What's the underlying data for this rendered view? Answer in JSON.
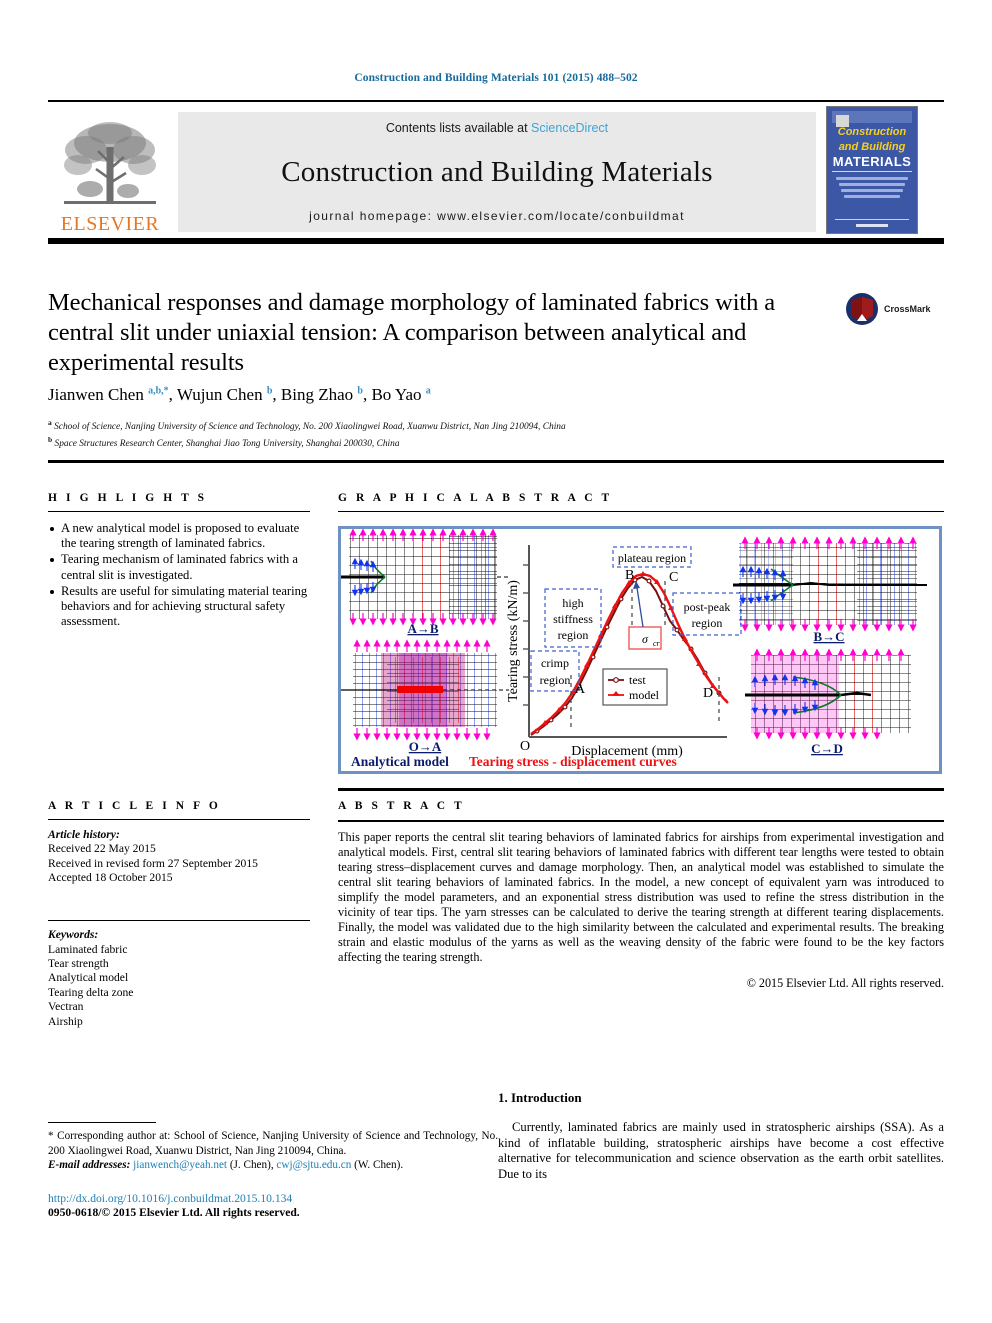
{
  "running_head": "Construction and Building Materials 101 (2015) 488–502",
  "masthead": {
    "contents_prefix": "Contents lists available at ",
    "sciencedirect": "ScienceDirect",
    "journal_name": "Construction and Building Materials",
    "homepage": "journal homepage: www.elsevier.com/locate/conbuildmat",
    "publisher_logo_text": "ELSEVIER",
    "cover": {
      "line1": "Construction",
      "line2": "and Building",
      "line3": "MATERIALS"
    }
  },
  "article": {
    "title": "Mechanical responses and damage morphology of laminated fabrics with a central slit under uniaxial tension: A comparison between analytical and experimental results",
    "crossmark_label": "CrossMark",
    "authors_html": "Jianwen Chen <sup>a,b,*</sup>, Wujun Chen <sup>b</sup>, Bing Zhao <sup>b</sup>, Bo Yao <sup>a</sup>",
    "affiliations": [
      {
        "marker": "a",
        "text": "School of Science, Nanjing University of Science and Technology, No. 200 Xiaolingwei Road, Xuanwu District, Nan Jing 210094, China"
      },
      {
        "marker": "b",
        "text": "Space Structures Research Center, Shanghai Jiao Tong University, Shanghai 200030, China"
      }
    ]
  },
  "highlights": {
    "heading": "H I G H L I G H T S",
    "items": [
      "A new analytical model is proposed to evaluate the tearing strength of laminated fabrics.",
      "Tearing mechanism of laminated fabrics with a central slit is investigated.",
      "Results are useful for simulating material tearing behaviors and for achieving structural safety assessment."
    ]
  },
  "graphical_abstract": {
    "heading": "G R A P H I C A L   A B S T R A C T",
    "caption_left": "Analytical model",
    "caption_right": "Tearing stress - displacement curves",
    "panel_labels": [
      "A→B",
      "O→A",
      "B→C",
      "C→D"
    ],
    "annotations": [
      "plateau region",
      "high stiffness region",
      "crimp region",
      "post-peak region"
    ],
    "stress_symbol": "σcr",
    "points": [
      "O",
      "A",
      "B",
      "C",
      "D"
    ]
  },
  "chart_data": {
    "type": "line",
    "title": "Tearing stress - displacement curves",
    "xlabel": "Displacement (mm)",
    "ylabel": "Tearing stress (kN/m)",
    "xlim": [
      0,
      10
    ],
    "ylim": [
      0,
      10
    ],
    "grid": false,
    "legend_position": "center",
    "annotations": [
      {
        "text": "plateau region",
        "x": 5.4,
        "y": 9.3
      },
      {
        "text": "high stiffness region",
        "x": 2.0,
        "y": 6.6
      },
      {
        "text": "crimp region",
        "x": 1.1,
        "y": 3.9
      },
      {
        "text": "post-peak region",
        "x": 7.8,
        "y": 6.3
      },
      {
        "text": "σcr",
        "x": 5.0,
        "y": 5.3
      }
    ],
    "markers": [
      {
        "label": "O",
        "x": 0.0,
        "y": 0.0
      },
      {
        "label": "A",
        "x": 2.0,
        "y": 1.9
      },
      {
        "label": "B",
        "x": 4.7,
        "y": 8.5
      },
      {
        "label": "C",
        "x": 6.2,
        "y": 8.5
      },
      {
        "label": "D",
        "x": 9.3,
        "y": 1.3
      }
    ],
    "series": [
      {
        "name": "test",
        "color": "#7a0f0f",
        "marker": "open-circle",
        "x": [
          0.0,
          0.3,
          0.6,
          0.9,
          1.2,
          1.5,
          1.8,
          2.1,
          2.4,
          2.7,
          3.0,
          3.3,
          3.6,
          3.9,
          4.2,
          4.5,
          4.8,
          5.1,
          5.4,
          5.7,
          6.0,
          6.3,
          6.6,
          6.9,
          7.2,
          7.5,
          7.8,
          8.1,
          8.4,
          8.7,
          9.0,
          9.3,
          9.5
        ],
        "y": [
          0.1,
          0.35,
          0.7,
          1.05,
          1.4,
          1.75,
          2.2,
          2.8,
          3.5,
          4.3,
          5.1,
          5.9,
          6.7,
          7.5,
          8.1,
          8.6,
          8.8,
          8.6,
          8.0,
          7.0,
          6.1,
          5.6,
          5.1,
          4.6,
          4.0,
          3.3,
          2.7,
          2.2,
          1.9,
          1.7,
          1.6,
          1.4,
          0.6
        ]
      },
      {
        "name": "model",
        "color": "#ee1111",
        "marker": "filled-triangle",
        "x": [
          0.0,
          0.3,
          0.6,
          0.9,
          1.2,
          1.5,
          1.8,
          2.1,
          2.4,
          2.7,
          3.0,
          3.3,
          3.6,
          3.9,
          4.2,
          4.5,
          4.8,
          5.1,
          5.4,
          5.7,
          6.0,
          6.3,
          6.6,
          6.9,
          7.2,
          7.5,
          7.8,
          8.1,
          8.4,
          8.7,
          9.0,
          9.3,
          9.5
        ],
        "y": [
          0.1,
          0.4,
          0.8,
          1.15,
          1.5,
          1.85,
          2.3,
          2.9,
          3.6,
          4.4,
          5.2,
          6.0,
          6.8,
          7.6,
          8.3,
          8.7,
          8.85,
          8.75,
          8.5,
          8.0,
          7.2,
          6.3,
          5.4,
          4.5,
          3.7,
          3.0,
          2.5,
          2.1,
          1.9,
          1.8,
          1.7,
          1.5,
          0.7
        ]
      }
    ]
  },
  "article_info": {
    "heading": "A R T I C L E   I N F O",
    "history_label": "Article history:",
    "history": [
      "Received 22 May 2015",
      "Received in revised form 27 September 2015",
      "Accepted 18 October 2015"
    ],
    "keywords_label": "Keywords:",
    "keywords": [
      "Laminated fabric",
      "Tear strength",
      "Analytical model",
      "Tearing delta zone",
      "Vectran",
      "Airship"
    ]
  },
  "abstract": {
    "heading": "A B S T R A C T",
    "text": "This paper reports the central slit tearing behaviors of laminated fabrics for airships from experimental investigation and analytical models. First, central slit tearing behaviors of laminated fabrics with different tear lengths were tested to obtain tearing stress–displacement curves and damage morphology. Then, an analytical model was established to simulate the central slit tearing behaviors of laminated fabrics. In the model, a new concept of equivalent yarn was introduced to simplify the model parameters, and an exponential stress distribution was used to refine the stress distribution in the vicinity of tear tips. The yarn stresses can be calculated to derive the tearing strength at different tearing displacements. Finally, the model was validated due to the high similarity between the calculated and experimental results. The breaking strain and elastic modulus of the yarns as well as the weaving density of the fabric were found to be the key factors affecting the tearing strength.",
    "copyright": "© 2015 Elsevier Ltd. All rights reserved."
  },
  "footer": {
    "corresponding_marker": "*",
    "corresponding": "Corresponding author at: School of Science, Nanjing University of Science and Technology, No. 200 Xiaolingwei Road, Xuanwu District, Nan Jing 210094, China.",
    "email_label": "E-mail addresses:",
    "email1": "jianwench@yeah.net",
    "email1_owner": "(J. Chen),",
    "email2": "cwj@sjtu.edu.cn",
    "email2_owner": "(W. Chen).",
    "doi": "http://dx.doi.org/10.1016/j.conbuildmat.2015.10.134",
    "issn": "0950-0618/© 2015 Elsevier Ltd. All rights reserved."
  },
  "introduction": {
    "heading": "1. Introduction",
    "text": "Currently, laminated fabrics are mainly used in stratospheric airships (SSA). As a kind of inflatable building, stratospheric airships have become a cost effective alternative for telecommunication and science observation as the earth orbit satellites. Due to its"
  },
  "colors": {
    "link": "#1f7fb5",
    "elsevier_orange": "#E87722",
    "frame_blue": "#6f92c4",
    "navy": "#0b1b6b",
    "red": "#ee1111"
  }
}
